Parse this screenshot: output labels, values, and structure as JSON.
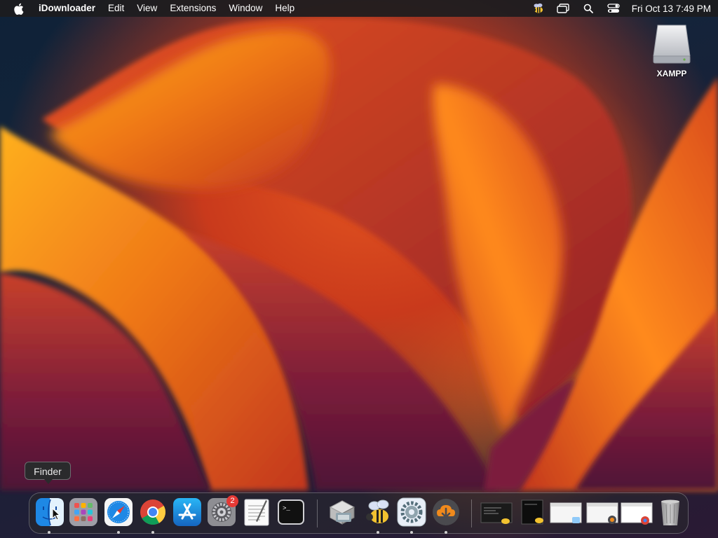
{
  "menubar": {
    "apple_icon": "apple-logo-icon",
    "app_name": "iDownloader",
    "menus": [
      "Edit",
      "View",
      "Extensions",
      "Window",
      "Help"
    ],
    "status_icons": [
      "bee-app-icon",
      "screen-mirroring-icon",
      "spotlight-search-icon",
      "control-center-icon"
    ],
    "clock": "Fri Oct 13  7:49 PM"
  },
  "desktop": {
    "drive_label": "XAMPP",
    "drive_icon": "external-drive-icon"
  },
  "tooltip": {
    "text": "Finder"
  },
  "dock": {
    "apps": [
      {
        "name": "Finder",
        "icon": "finder-icon",
        "running": true
      },
      {
        "name": "Launchpad",
        "icon": "launchpad-icon",
        "running": false
      },
      {
        "name": "Safari",
        "icon": "safari-icon",
        "running": true
      },
      {
        "name": "Google Chrome",
        "icon": "chrome-icon",
        "running": true
      },
      {
        "name": "App Store",
        "icon": "app-store-icon",
        "running": false
      },
      {
        "name": "System Preferences",
        "icon": "system-preferences-icon",
        "running": false,
        "badge": "2"
      },
      {
        "name": "TextEdit",
        "icon": "textedit-icon",
        "running": false
      },
      {
        "name": "Terminal",
        "icon": "terminal-icon",
        "running": false
      },
      {
        "name": "Installer",
        "icon": "installer-icon",
        "running": false
      },
      {
        "name": "Bee App",
        "icon": "bee-icon",
        "running": true
      },
      {
        "name": "Settings App",
        "icon": "gear-app-icon",
        "running": true
      },
      {
        "name": "iDownloader",
        "icon": "download-cloud-icon",
        "running": true
      }
    ],
    "minimized": [
      {
        "icon": "terminal-window-thumbnail-icon"
      },
      {
        "icon": "dark-window-thumbnail-icon"
      },
      {
        "icon": "finder-window-thumbnail-icon"
      },
      {
        "icon": "downloader-window-thumbnail-icon"
      },
      {
        "icon": "chrome-window-thumbnail-icon"
      }
    ],
    "trash_icon": "trash-icon"
  },
  "colors": {
    "menubar_bg": "#1c1c1e",
    "wallpaper_orange": "#f08a1c",
    "wallpaper_red": "#c93a1c",
    "wallpaper_dark": "#0f2238",
    "badge_red": "#e53935"
  }
}
